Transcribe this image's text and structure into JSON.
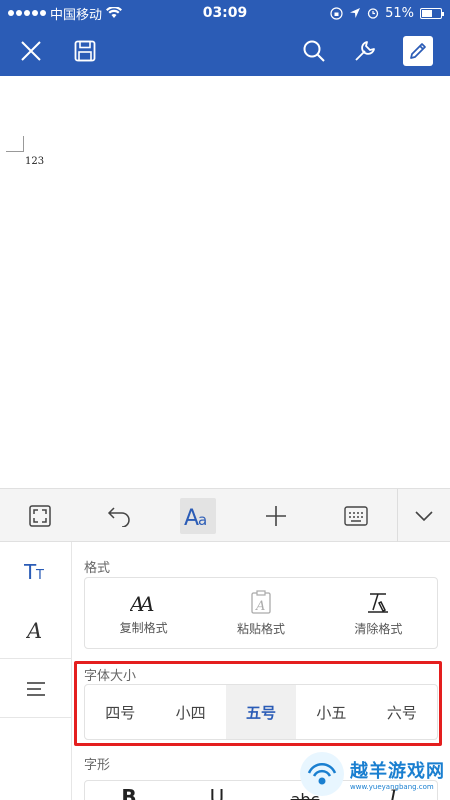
{
  "status_bar": {
    "carrier": "中国移动",
    "time": "03:09",
    "battery": "51%",
    "battery_level": 0.51
  },
  "toolbar": {
    "close_icon": "close-icon",
    "save_icon": "save-icon",
    "search_icon": "search-icon",
    "tools_icon": "wrench-icon",
    "edit_icon": "pencil-icon"
  },
  "document": {
    "page_number": "123"
  },
  "ribbon": {
    "items": [
      "fullscreen-icon",
      "undo-icon",
      "font-format-icon",
      "insert-icon",
      "keyboard-icon",
      "collapse-icon"
    ]
  },
  "sidebar": {
    "items": [
      {
        "icon": "text-style-icon",
        "label": "TT"
      },
      {
        "icon": "font-icon",
        "label": "A"
      },
      {
        "icon": "paragraph-icon"
      }
    ]
  },
  "panel": {
    "format": {
      "title": "格式",
      "buttons": [
        {
          "label": "复制格式",
          "icon": "copy-format-icon"
        },
        {
          "label": "粘贴格式",
          "icon": "paste-format-icon"
        },
        {
          "label": "清除格式",
          "icon": "clear-format-icon"
        }
      ]
    },
    "font_size": {
      "title": "字体大小",
      "options": [
        "四号",
        "小四",
        "五号",
        "小五",
        "六号"
      ],
      "selected": "五号"
    },
    "font_style": {
      "title": "字形",
      "buttons": [
        "B",
        "U",
        "abc",
        "I"
      ]
    }
  },
  "watermark": {
    "text": "越羊游戏网",
    "url": "www.yueyangbang.com"
  },
  "colors": {
    "accent": "#2b5cb6",
    "highlight": "#e41e1e"
  }
}
